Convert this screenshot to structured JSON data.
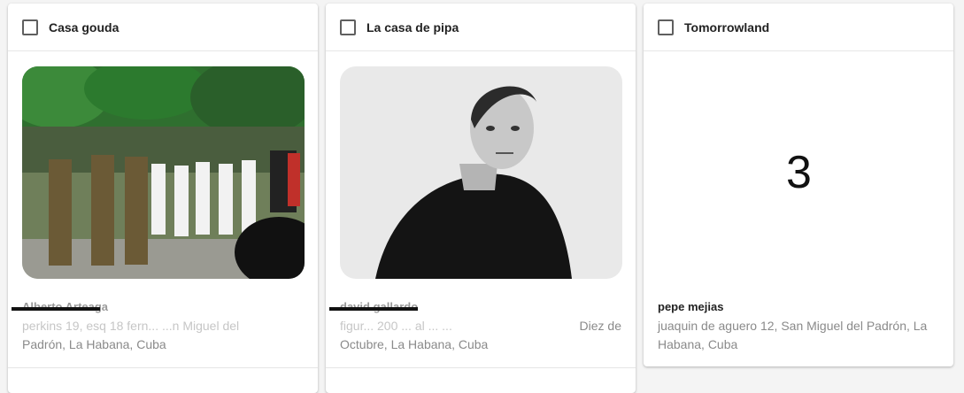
{
  "cards": [
    {
      "title": "Casa gouda",
      "name": "Alberto Arteaga",
      "address_line1": "perkins 19, esq 18 fern... ...n Miguel del",
      "address_line2": "Padrón, La Habana, Cuba"
    },
    {
      "title": "La casa de pipa",
      "name": "david gallardo",
      "address_line1_a": "figur... 200 ... al ... ...",
      "address_line1_b": "Diez de",
      "address_line2": "Octubre, La Habana, Cuba"
    },
    {
      "title": "Tomorrowland",
      "number": "3",
      "name": "pepe mejias",
      "address_line1": "juaquin de aguero 12, San Miguel del Padrón, La",
      "address_line2": "Habana, Cuba"
    }
  ]
}
